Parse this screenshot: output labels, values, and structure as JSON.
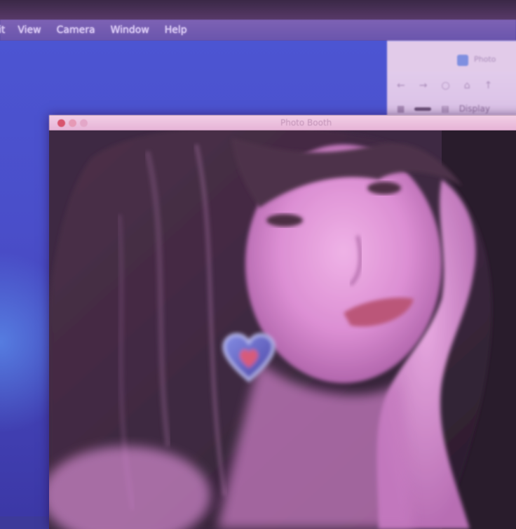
{
  "menubar": {
    "items": [
      "it",
      "View",
      "Camera",
      "Window",
      "Help"
    ]
  },
  "finder_window": {
    "tab_title": "Photo",
    "toolbar_label": "Display"
  },
  "photo_booth": {
    "title": "Photo Booth"
  },
  "colors": {
    "desktop": "#4a4ec9",
    "menubar": "#6a55ad",
    "titlebar": "#e6b3d6",
    "preview_tint": "#d98fd0"
  }
}
